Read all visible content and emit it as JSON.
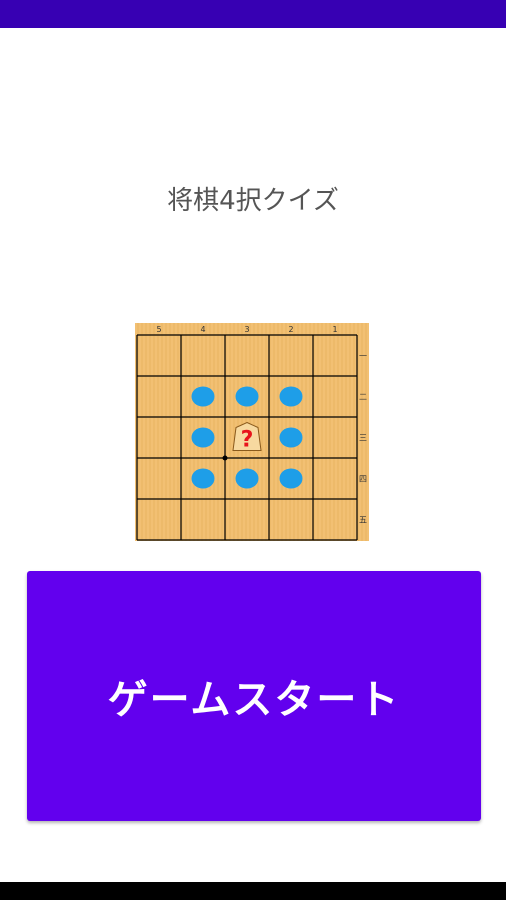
{
  "app": {
    "title": "将棋4択クイズ",
    "start_button_label": "ゲームスタート"
  },
  "board": {
    "column_labels": [
      "5",
      "4",
      "3",
      "2",
      "1"
    ],
    "row_labels": [
      "一",
      "二",
      "三",
      "四",
      "五"
    ],
    "center_piece_label": "?",
    "colors": {
      "board": "#f2c073",
      "grain": "#e0a955",
      "lines": "#000000",
      "move_dot": "#1e9ee8",
      "piece": "#f7d9a0",
      "question_mark": "#e8141c"
    }
  },
  "colors": {
    "status_bar": "#3700b3",
    "button": "#6200ee",
    "button_text": "#ffffff",
    "title_text": "#555555"
  }
}
